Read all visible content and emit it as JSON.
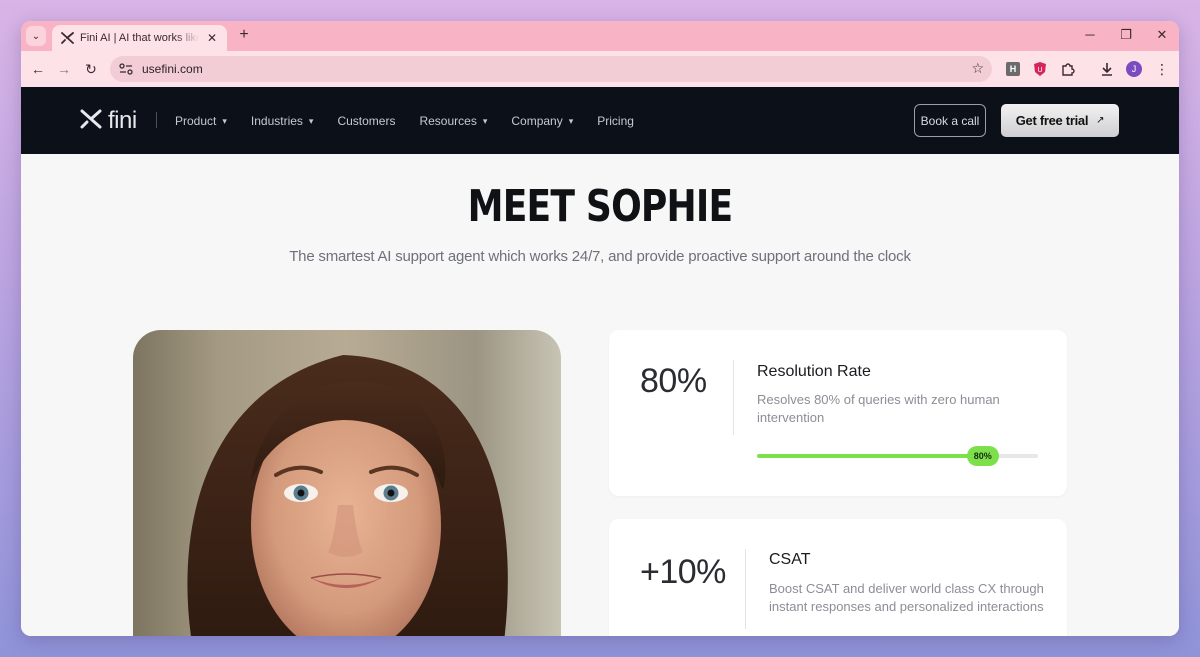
{
  "browser": {
    "tab_title": "Fini AI | AI that works like your best agent",
    "url": "usefini.com",
    "profile_initial": "J",
    "colors": {
      "tabstrip": "#f8b4c4",
      "toolbar": "#fde2e8"
    }
  },
  "site_nav": {
    "logo_text": "fini",
    "links": [
      {
        "label": "Product",
        "dropdown": true
      },
      {
        "label": "Industries",
        "dropdown": true
      },
      {
        "label": "Customers",
        "dropdown": false
      },
      {
        "label": "Resources",
        "dropdown": true
      },
      {
        "label": "Company",
        "dropdown": true
      },
      {
        "label": "Pricing",
        "dropdown": false
      }
    ],
    "book_call_label": "Book a call",
    "trial_label": "Get free trial",
    "trial_arrow": "↗"
  },
  "hero": {
    "title": "MEET SOPHIE",
    "subtitle": "The smartest AI support agent which works 24/7, and provide proactive support around the clock"
  },
  "stats": [
    {
      "value": "80%",
      "title": "Resolution Rate",
      "description": "Resolves 80% of queries with zero human intervention",
      "progress_label": "80%",
      "progress": 0.8,
      "progress_color": "#7be04a"
    },
    {
      "value": "+10%",
      "title": "CSAT",
      "description": "Boost CSAT and deliver world class CX through instant responses and personalized interactions"
    }
  ]
}
